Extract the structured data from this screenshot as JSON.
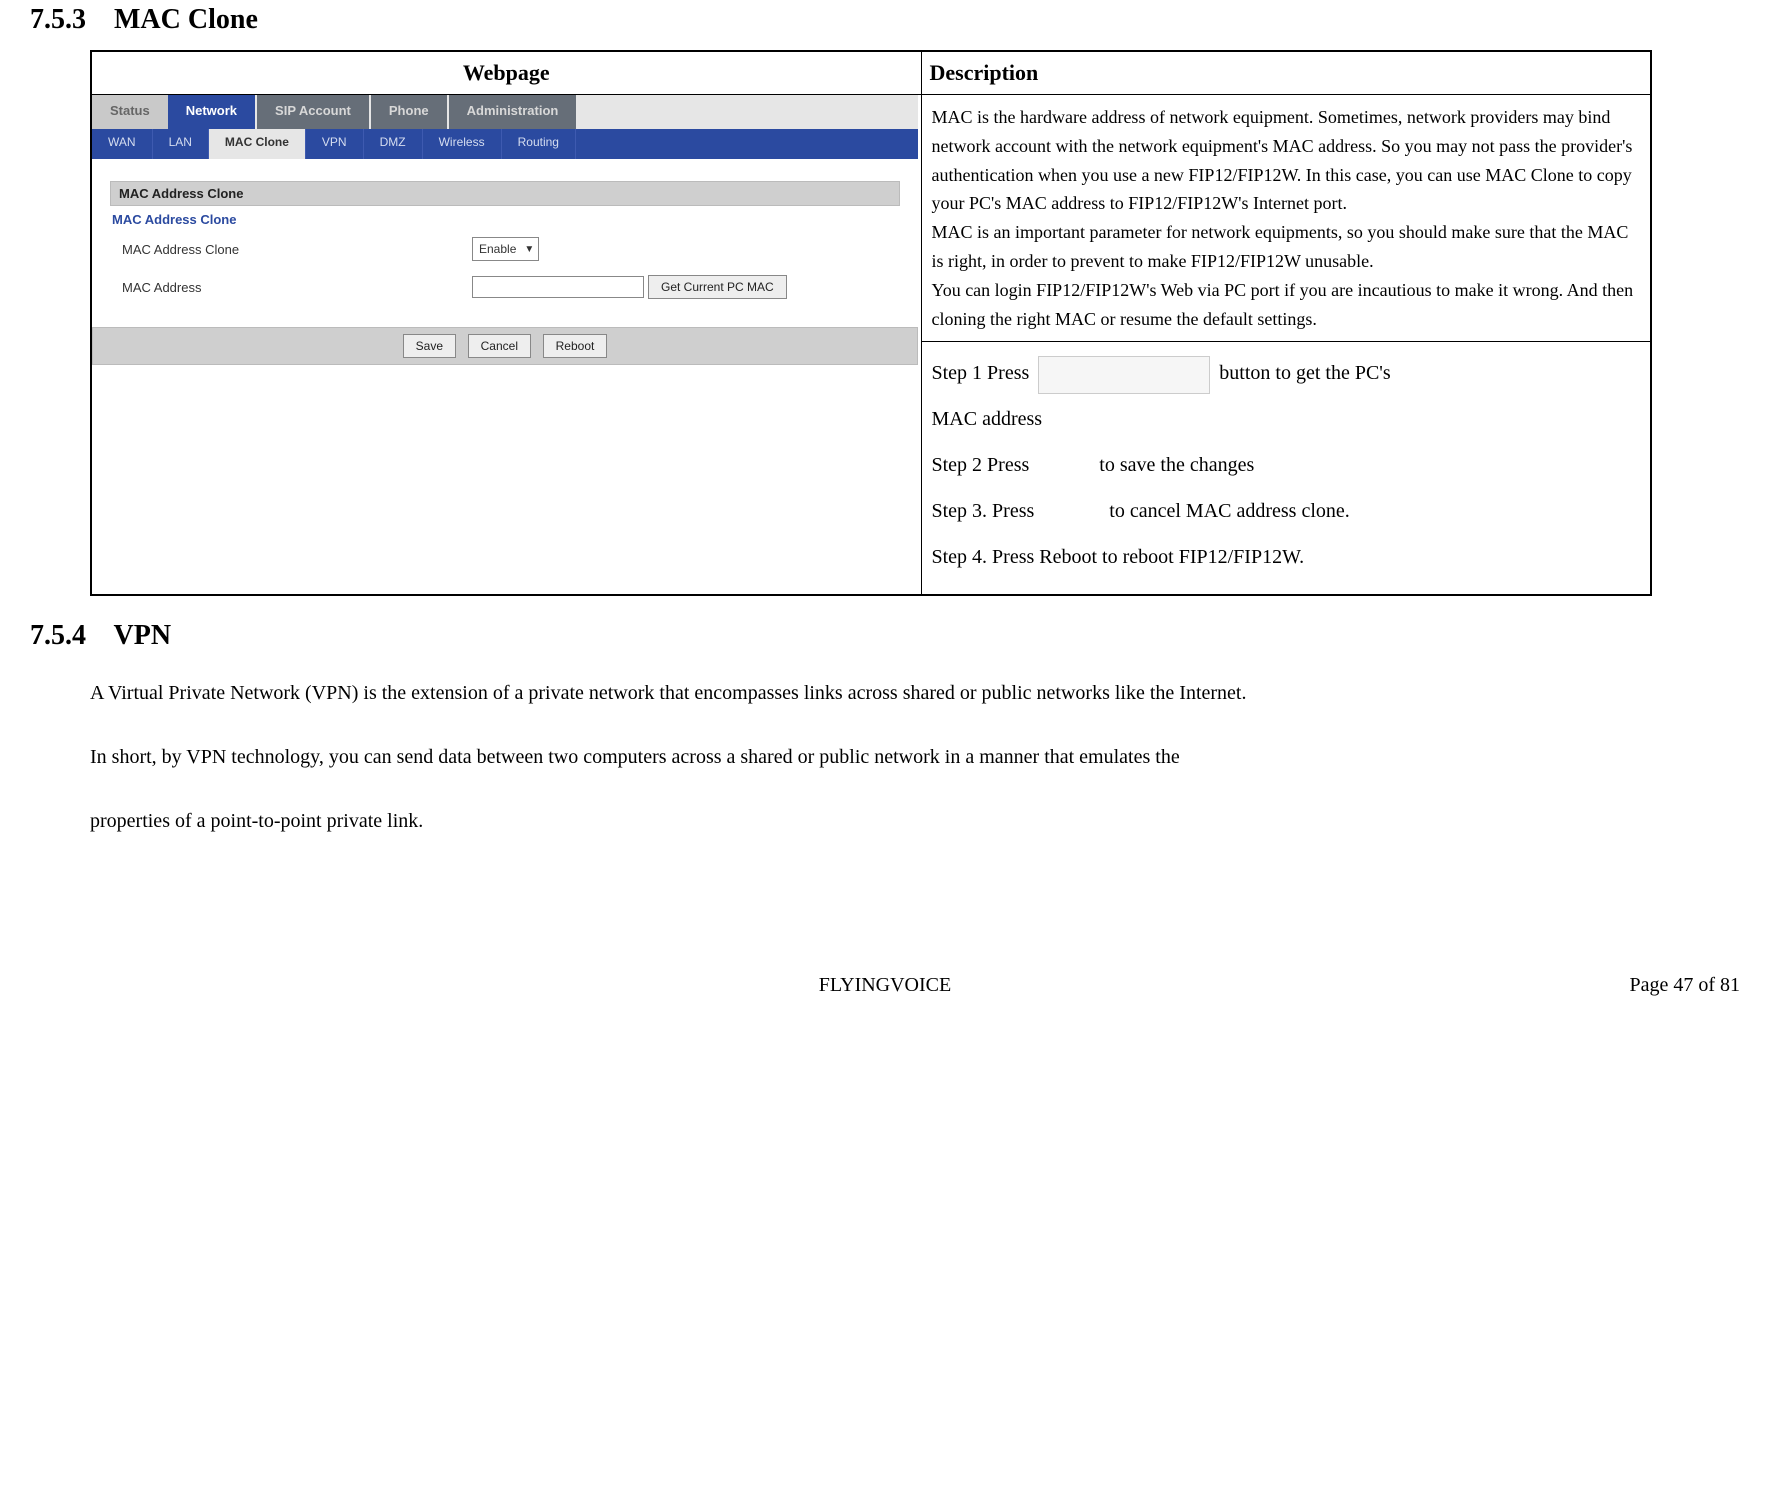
{
  "section1": {
    "number": "7.5.3",
    "title": "MAC Clone"
  },
  "table": {
    "headers": {
      "webpage": "Webpage",
      "description": "Description"
    },
    "description": "MAC is the hardware address of network equipment. Sometimes, network providers may bind network account with the network equipment's MAC address. So you may not pass the provider's authentication when you use a new FIP12/FIP12W. In this case, you can use MAC Clone to copy your PC's MAC address to FIP12/FIP12W's Internet port.\nMAC is an important parameter for network equipments, so you should make sure that the MAC is right, in order to prevent to make FIP12/FIP12W unusable.\nYou can login FIP12/FIP12W's Web via PC port if you are incautious to make it wrong. And then cloning the right MAC or resume the default settings.",
    "steps": {
      "s1a": "Step 1 Press",
      "s1b": "button to get the PC's",
      "s1c": "MAC address",
      "s2a": "Step 2 Press",
      "s2b": "to save the changes",
      "s3a": "Step 3. Press",
      "s3b": "to cancel MAC address clone.",
      "s4": "Step 4. Press Reboot to reboot FIP12/FIP12W."
    }
  },
  "screenshot": {
    "top_tabs": {
      "status": "Status",
      "network": "Network",
      "sip": "SIP Account",
      "phone": "Phone",
      "admin": "Administration"
    },
    "sub_tabs": {
      "wan": "WAN",
      "lan": "LAN",
      "mac_clone": "MAC Clone",
      "vpn": "VPN",
      "dmz": "DMZ",
      "wireless": "Wireless",
      "routing": "Routing"
    },
    "panel_title": "MAC Address Clone",
    "section_label": "MAC Address Clone",
    "row1_label": "MAC Address Clone",
    "row1_value": "Enable",
    "row2_label": "MAC Address",
    "get_mac_btn": "Get Current PC MAC",
    "save_btn": "Save",
    "cancel_btn": "Cancel",
    "reboot_btn": "Reboot"
  },
  "section2": {
    "number": "7.5.4",
    "title": "VPN"
  },
  "para1": "A Virtual Private Network (VPN) is the extension of a private network that encompasses links across shared or public networks like the Internet.",
  "para2": "In short, by VPN technology, you can send data between two computers across a shared or public network in a manner that emulates the",
  "para3": "properties of a point-to-point private link.",
  "footer": {
    "center": "FLYINGVOICE",
    "right": "Page  47  of  81"
  }
}
